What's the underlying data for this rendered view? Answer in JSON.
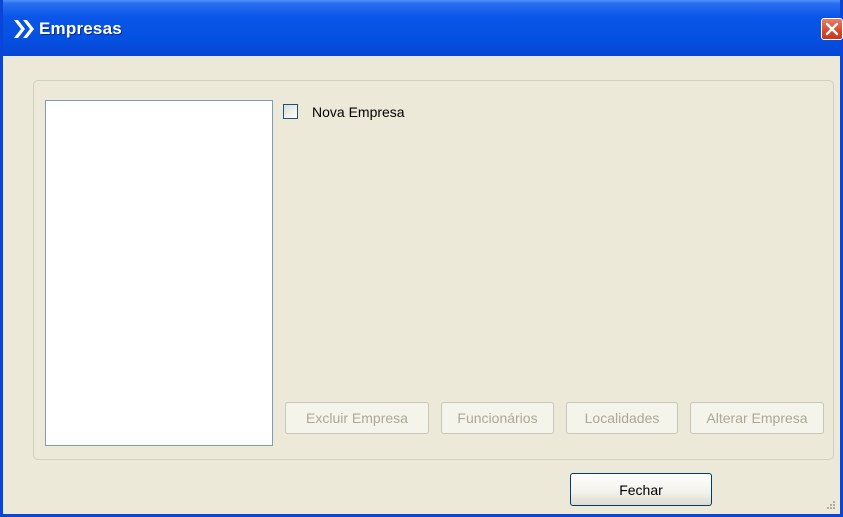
{
  "window": {
    "title": "Empresas",
    "colors": {
      "titlebar": "#0450e0",
      "body": "#ece9d8",
      "close": "#d9472a"
    }
  },
  "new_company_checkbox": {
    "label": "Nova Empresa",
    "checked": false
  },
  "action_buttons": {
    "delete_label": "Excluir Empresa",
    "employees_label": "Funcionários",
    "locations_label": "Localidades",
    "edit_label": "Alterar Empresa"
  },
  "footer": {
    "close_label": "Fechar"
  }
}
